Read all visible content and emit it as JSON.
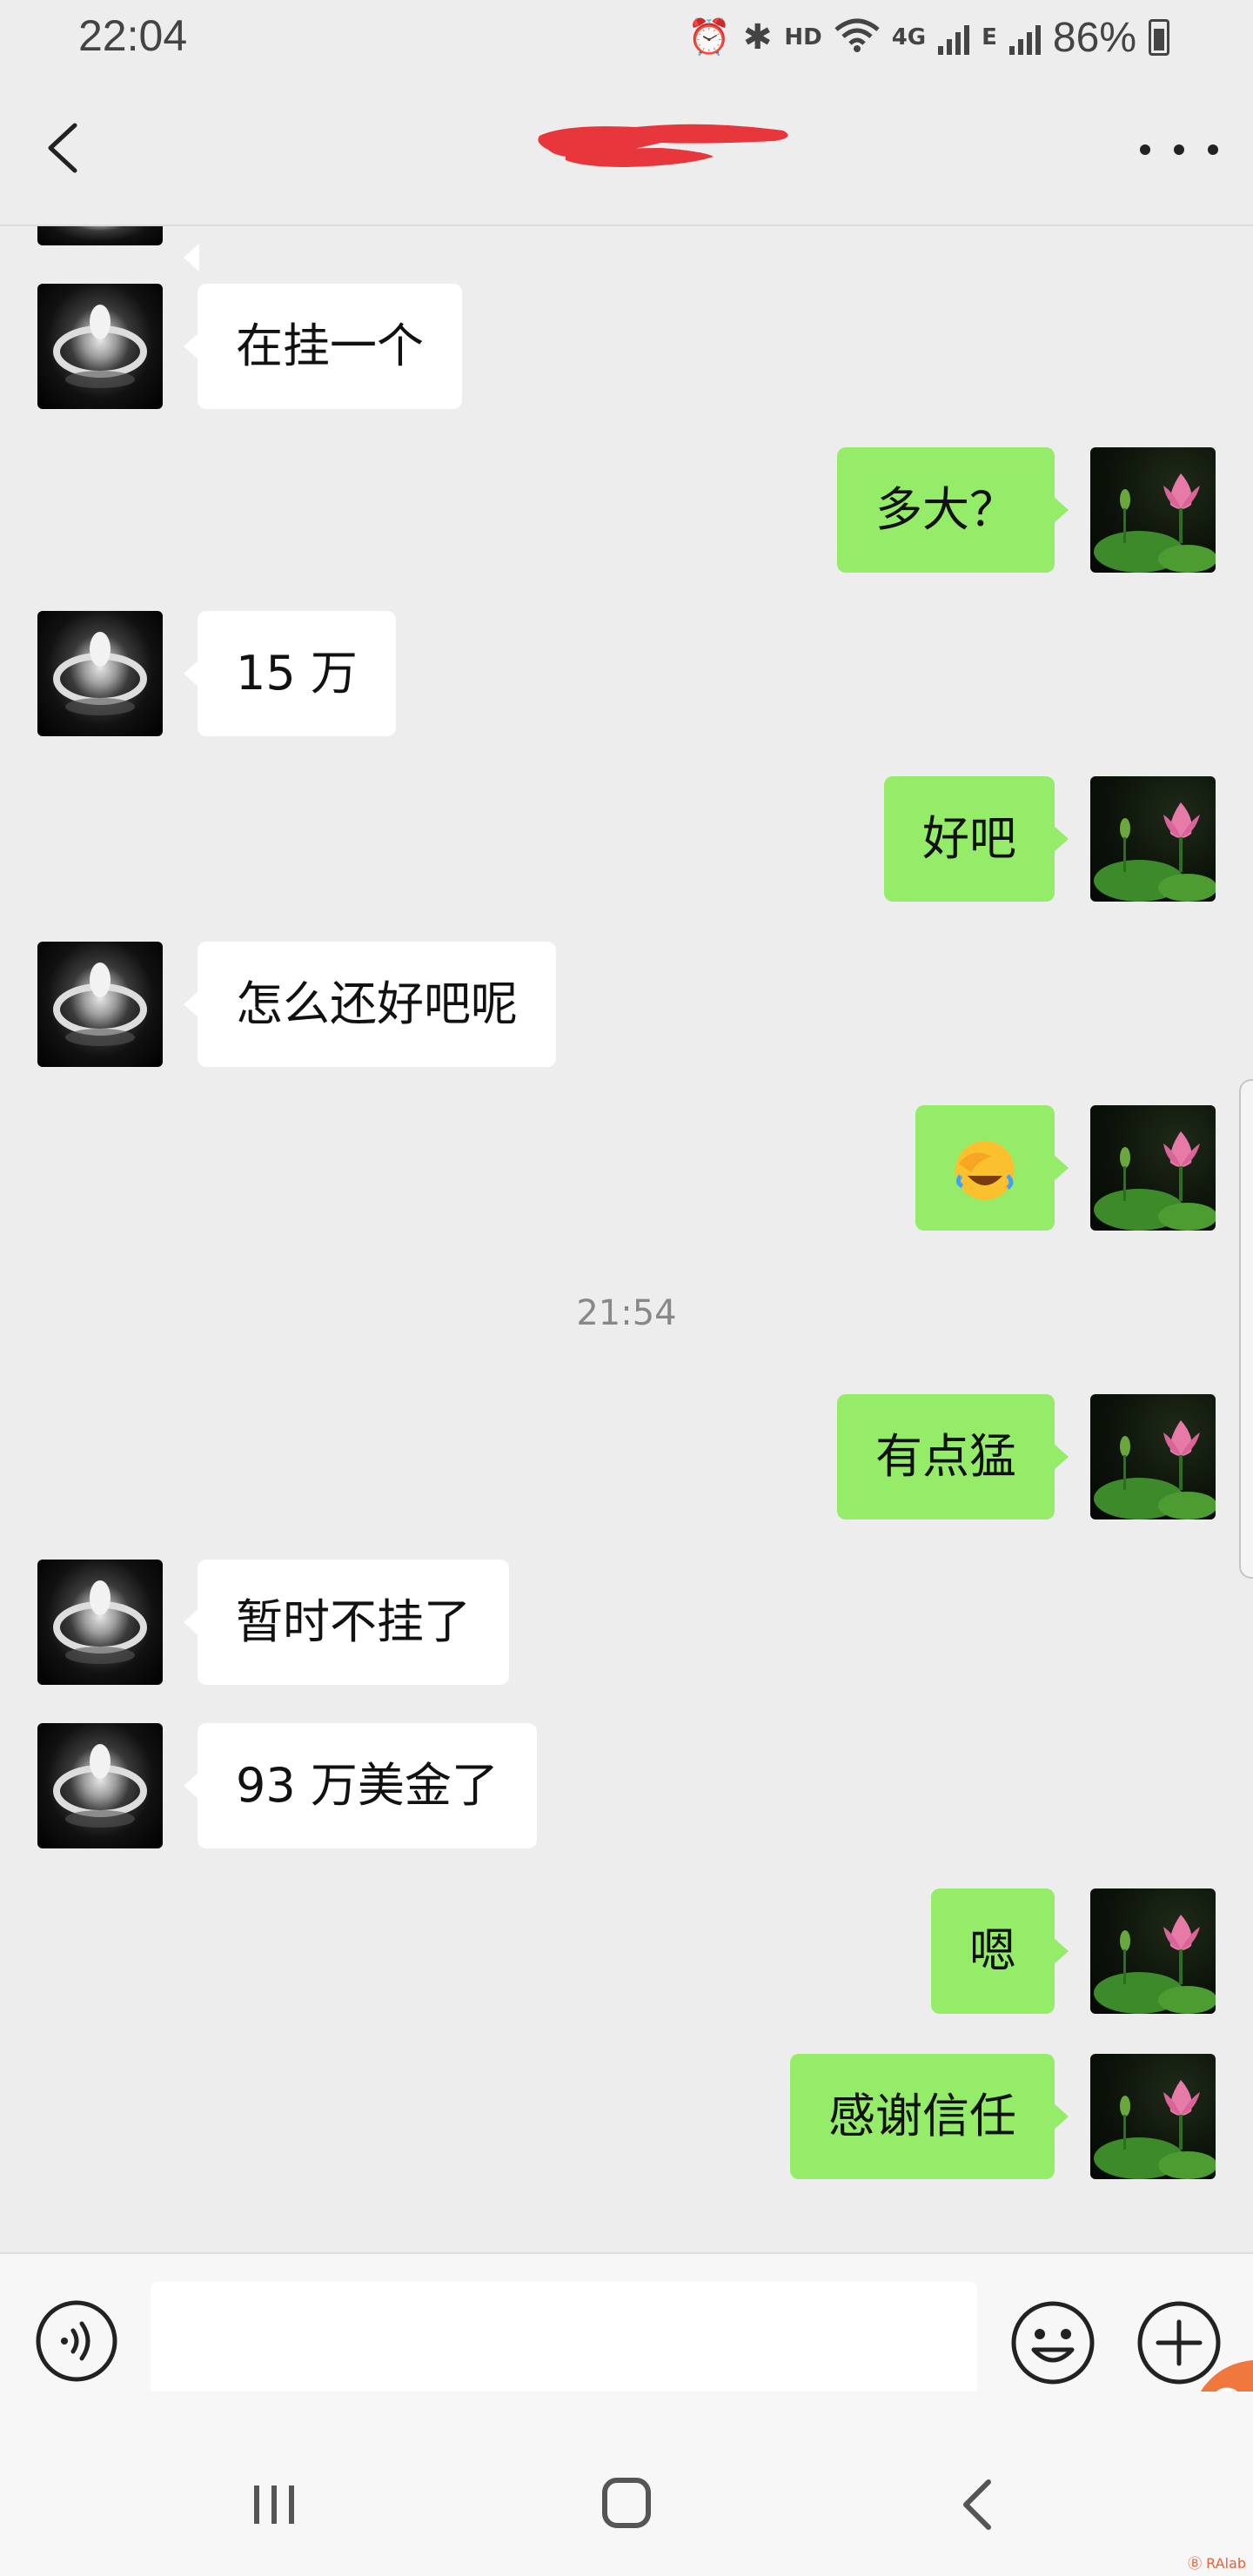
{
  "status_bar": {
    "time": "22:04",
    "indicators": [
      "alarm-icon",
      "bluetooth-icon",
      "HD",
      "wifi-icon",
      "4G",
      "signal-icon",
      "E",
      "signal-icon"
    ],
    "hd_label": "HD",
    "network_label": "4G",
    "network2_label": "E",
    "battery": "86%"
  },
  "header": {
    "back_icon": "chevron-left-icon",
    "title_redaction_color": "#e8373c",
    "more_icon": "more-dots-icon"
  },
  "chat": {
    "messages": [
      {
        "side": "left",
        "type": "text",
        "text": "在挂一个"
      },
      {
        "side": "right",
        "type": "text",
        "text": "多大？"
      },
      {
        "side": "left",
        "type": "text",
        "text": "15 万"
      },
      {
        "side": "right",
        "type": "text",
        "text": "好吧"
      },
      {
        "side": "left",
        "type": "text",
        "text": "怎么还好吧呢"
      },
      {
        "side": "right",
        "type": "emoji",
        "emoji": "facepalm-laugh-emoji"
      },
      {
        "side": "center",
        "type": "time",
        "text": "21:54"
      },
      {
        "side": "right",
        "type": "text",
        "text": "有点猛"
      },
      {
        "side": "left",
        "type": "text",
        "text": "暂时不挂了"
      },
      {
        "side": "left",
        "type": "text",
        "text": "93 万美金了"
      },
      {
        "side": "right",
        "type": "text",
        "text": "嗯"
      },
      {
        "side": "right",
        "type": "text",
        "text": "感谢信任"
      }
    ],
    "left_avatar": "ring-avatar",
    "right_avatar": "lotus-avatar",
    "bubble_colors": {
      "left": "#ffffff",
      "right": "#95ec69"
    }
  },
  "input_bar": {
    "voice_icon": "voice-icon",
    "text_value": "",
    "emoji_icon": "emoji-icon",
    "plus_icon": "plus-icon"
  },
  "nav_bar": {
    "recent_icon": "recent-apps-icon",
    "home_icon": "home-icon",
    "back_icon": "back-icon"
  },
  "watermark": "Ⓑ RAlab"
}
